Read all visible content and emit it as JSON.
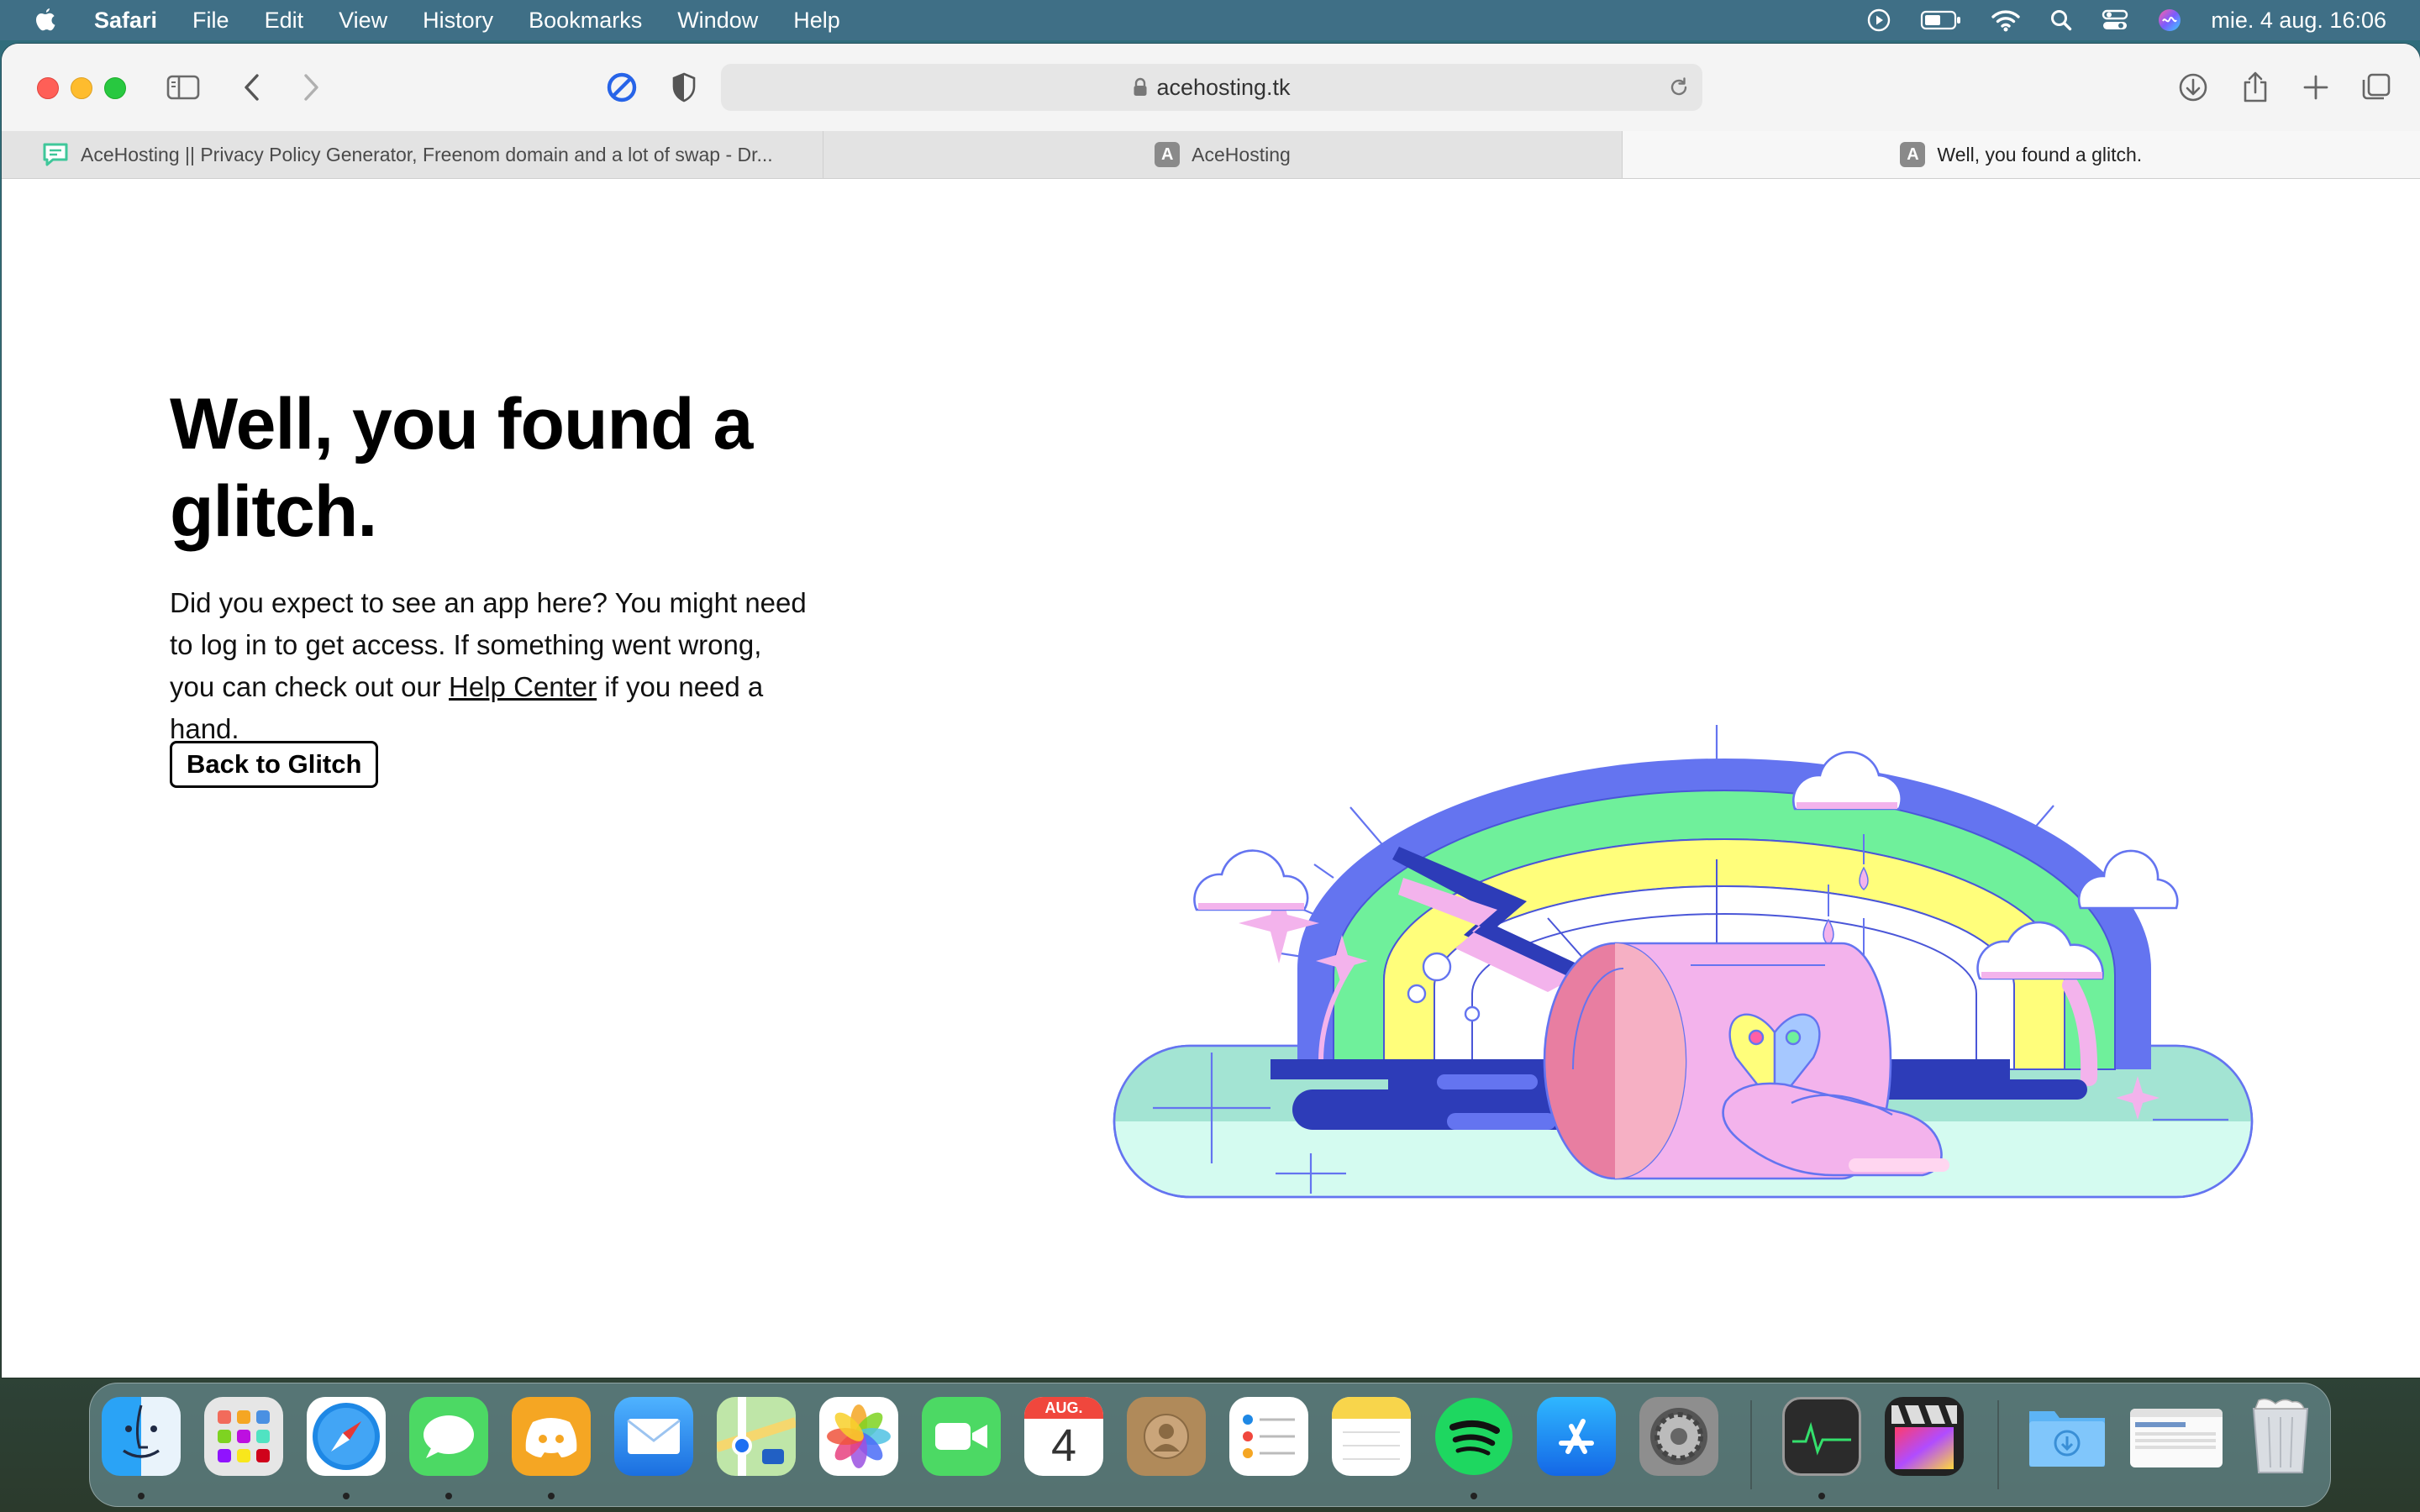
{
  "menubar": {
    "app_name": "Safari",
    "menus": [
      "File",
      "Edit",
      "View",
      "History",
      "Bookmarks",
      "Window",
      "Help"
    ],
    "clock": "mie. 4 aug.  16:06"
  },
  "browser": {
    "url": "acehosting.tk",
    "tabs": [
      {
        "title": "AceHosting || Privacy Policy Generator, Freenom domain and a lot of swap - Dr...",
        "favicon": "chat-favicon-icon"
      },
      {
        "title": "AceHosting",
        "favicon": "A"
      },
      {
        "title": "Well, you found a glitch.",
        "favicon": "A"
      }
    ]
  },
  "page": {
    "headline": "Well, you found a glitch.",
    "description_before": "Did you expect to see an app here? You might need to log in to get access. If something went wrong, you can check out our ",
    "help_link": "Help Center",
    "description_after": " if you need a hand.",
    "back_button": "Back to Glitch"
  },
  "dock": {
    "calendar_month": "AUG.",
    "calendar_day": "4",
    "apps": [
      "Finder",
      "Launchpad",
      "Safari",
      "Messages",
      "Discord",
      "Mail",
      "Maps",
      "Photos",
      "FaceTime",
      "Calendar",
      "Contacts",
      "Reminders",
      "Notes",
      "Spotify",
      "App Store",
      "System Preferences",
      "Activity Monitor",
      "Final Cut Pro",
      "Downloads",
      "Window preview",
      "Trash"
    ]
  },
  "colors": {
    "menubar_bg": "#3f6f86",
    "rainbow_blue": "#6474f0",
    "rainbow_green": "#6ff09b",
    "rainbow_yellow": "#fffe7b",
    "pink": "#f3b3ec",
    "mint": "#d4fbf0"
  }
}
